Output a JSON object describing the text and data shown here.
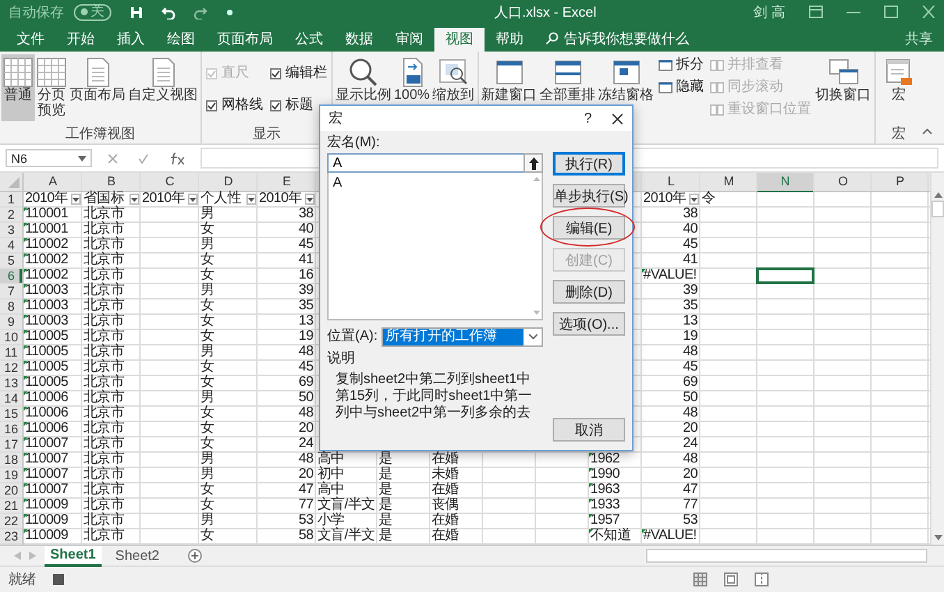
{
  "title_bar": {
    "autosave": {
      "label": "自动保存",
      "on": false,
      "state": "关"
    },
    "document_title": "人口.xlsx - Excel",
    "user": "剑 高"
  },
  "menu_tabs": [
    {
      "label": "文件",
      "selected": false
    },
    {
      "label": "开始",
      "selected": false
    },
    {
      "label": "插入",
      "selected": false
    },
    {
      "label": "绘图",
      "selected": false
    },
    {
      "label": "页面布局",
      "selected": false
    },
    {
      "label": "公式",
      "selected": false
    },
    {
      "label": "数据",
      "selected": false
    },
    {
      "label": "审阅",
      "selected": false
    },
    {
      "label": "视图",
      "selected": true
    },
    {
      "label": "帮助",
      "selected": false
    }
  ],
  "tell_me": "告诉我你想要做什么",
  "share": "共享",
  "ribbon": {
    "workbook_views": {
      "label": "工作簿视图",
      "items": [
        {
          "label": "普通",
          "selected": true
        },
        {
          "label": "分页预览",
          "selected": false
        },
        {
          "label": "页面布局",
          "selected": false
        },
        {
          "label": "自定义视图",
          "selected": false
        }
      ]
    },
    "show": {
      "label": "显示",
      "checkboxes": [
        {
          "label": "直尺",
          "checked": true,
          "disabled": true
        },
        {
          "label": "编辑栏",
          "checked": true,
          "disabled": false
        },
        {
          "label": "网格线",
          "checked": true,
          "disabled": false
        },
        {
          "label": "标题",
          "checked": true,
          "disabled": false
        }
      ]
    },
    "zoom": {
      "items": [
        {
          "label": "显示比例"
        },
        {
          "label": "100%"
        },
        {
          "label": "缩放到"
        }
      ]
    },
    "window": {
      "large": [
        {
          "label": "新建窗口"
        },
        {
          "label": "全部重排"
        },
        {
          "label": "冻结窗格"
        }
      ],
      "small": [
        {
          "label": "拆分",
          "disabled": false
        },
        {
          "label": "隐藏",
          "disabled": false
        }
      ],
      "small2": [
        {
          "label": "并排查看",
          "disabled": true
        },
        {
          "label": "同步滚动",
          "disabled": true
        },
        {
          "label": "重设窗口位置",
          "disabled": true
        }
      ],
      "switch": "切换窗口"
    },
    "macros": {
      "label": "宏",
      "button": "宏"
    }
  },
  "formula_bar": {
    "name_box": "N6"
  },
  "columns": [
    {
      "label": "A",
      "selected": false
    },
    {
      "label": "B",
      "selected": false
    },
    {
      "label": "C",
      "selected": false
    },
    {
      "label": "D",
      "selected": false
    },
    {
      "label": "E",
      "selected": false
    },
    null,
    null,
    null,
    null,
    null,
    null,
    {
      "label": "L",
      "selected": false
    },
    {
      "label": "M",
      "selected": false
    },
    {
      "label": "N",
      "selected": true
    },
    {
      "label": "O",
      "selected": false
    },
    {
      "label": "P",
      "selected": false
    }
  ],
  "rows": [
    {
      "number": "1",
      "selected": false,
      "cells": [
        {
          "kind": "header",
          "text": "2010年"
        },
        {
          "kind": "header",
          "text": "省国标"
        },
        {
          "kind": "header",
          "text": "2010年"
        },
        {
          "kind": "header",
          "text": "个人性"
        },
        {
          "kind": "header",
          "text": "2010年"
        },
        null,
        null,
        null,
        null,
        null,
        null,
        {
          "kind": "header",
          "text": "2010年"
        },
        {
          "kind": "text",
          "text": "令"
        },
        null,
        null,
        null
      ]
    },
    {
      "number": "2",
      "selected": false,
      "cells": [
        {
          "kind": "flagged",
          "text": "110001"
        },
        {
          "kind": "text",
          "text": "北京市"
        },
        null,
        {
          "kind": "text",
          "text": "男"
        },
        {
          "kind": "number",
          "text": "38"
        },
        null,
        null,
        null,
        null,
        null,
        null,
        {
          "kind": "number",
          "text": "38"
        },
        null,
        null,
        null,
        null
      ]
    },
    {
      "number": "3",
      "selected": false,
      "cells": [
        {
          "kind": "flagged",
          "text": "110001"
        },
        {
          "kind": "text",
          "text": "北京市"
        },
        null,
        {
          "kind": "text",
          "text": "女"
        },
        {
          "kind": "number",
          "text": "40"
        },
        null,
        null,
        null,
        null,
        null,
        null,
        {
          "kind": "number",
          "text": "40"
        },
        null,
        null,
        null,
        null
      ]
    },
    {
      "number": "4",
      "selected": false,
      "cells": [
        {
          "kind": "flagged",
          "text": "110002"
        },
        {
          "kind": "text",
          "text": "北京市"
        },
        null,
        {
          "kind": "text",
          "text": "男"
        },
        {
          "kind": "number",
          "text": "45"
        },
        null,
        null,
        null,
        null,
        null,
        null,
        {
          "kind": "number",
          "text": "45"
        },
        null,
        null,
        null,
        null
      ]
    },
    {
      "number": "5",
      "selected": false,
      "cells": [
        {
          "kind": "flagged",
          "text": "110002"
        },
        {
          "kind": "text",
          "text": "北京市"
        },
        null,
        {
          "kind": "text",
          "text": "女"
        },
        {
          "kind": "number",
          "text": "41"
        },
        null,
        null,
        null,
        null,
        null,
        null,
        {
          "kind": "number",
          "text": "41"
        },
        null,
        null,
        null,
        null
      ]
    },
    {
      "number": "6",
      "selected": true,
      "cells": [
        {
          "kind": "flagged",
          "text": "110002"
        },
        {
          "kind": "text",
          "text": "北京市"
        },
        null,
        {
          "kind": "text",
          "text": "女"
        },
        {
          "kind": "number",
          "text": "16"
        },
        null,
        null,
        null,
        null,
        null,
        null,
        {
          "kind": "flagged",
          "text": "#VALUE!"
        },
        null,
        {
          "kind": "cursor"
        },
        null,
        null
      ]
    },
    {
      "number": "7",
      "selected": false,
      "cells": [
        {
          "kind": "flagged",
          "text": "110003"
        },
        {
          "kind": "text",
          "text": "北京市"
        },
        null,
        {
          "kind": "text",
          "text": "男"
        },
        {
          "kind": "number",
          "text": "39"
        },
        null,
        null,
        null,
        null,
        null,
        null,
        {
          "kind": "number",
          "text": "39"
        },
        null,
        null,
        null,
        null
      ]
    },
    {
      "number": "8",
      "selected": false,
      "cells": [
        {
          "kind": "flagged",
          "text": "110003"
        },
        {
          "kind": "text",
          "text": "北京市"
        },
        null,
        {
          "kind": "text",
          "text": "女"
        },
        {
          "kind": "number",
          "text": "35"
        },
        null,
        null,
        null,
        null,
        null,
        null,
        {
          "kind": "number",
          "text": "35"
        },
        null,
        null,
        null,
        null
      ]
    },
    {
      "number": "9",
      "selected": false,
      "cells": [
        {
          "kind": "flagged",
          "text": "110003"
        },
        {
          "kind": "text",
          "text": "北京市"
        },
        null,
        {
          "kind": "text",
          "text": "女"
        },
        {
          "kind": "number",
          "text": "13"
        },
        null,
        null,
        null,
        null,
        null,
        null,
        {
          "kind": "number",
          "text": "13"
        },
        null,
        null,
        null,
        null
      ]
    },
    {
      "number": "10",
      "selected": false,
      "cells": [
        {
          "kind": "flagged",
          "text": "110005"
        },
        {
          "kind": "text",
          "text": "北京市"
        },
        null,
        {
          "kind": "text",
          "text": "女"
        },
        {
          "kind": "number",
          "text": "19"
        },
        null,
        null,
        null,
        null,
        null,
        null,
        {
          "kind": "number",
          "text": "19"
        },
        null,
        null,
        null,
        null
      ]
    },
    {
      "number": "11",
      "selected": false,
      "cells": [
        {
          "kind": "flagged",
          "text": "110005"
        },
        {
          "kind": "text",
          "text": "北京市"
        },
        null,
        {
          "kind": "text",
          "text": "男"
        },
        {
          "kind": "number",
          "text": "48"
        },
        null,
        null,
        null,
        null,
        null,
        null,
        {
          "kind": "number",
          "text": "48"
        },
        null,
        null,
        null,
        null
      ]
    },
    {
      "number": "12",
      "selected": false,
      "cells": [
        {
          "kind": "flagged",
          "text": "110005"
        },
        {
          "kind": "text",
          "text": "北京市"
        },
        null,
        {
          "kind": "text",
          "text": "女"
        },
        {
          "kind": "number",
          "text": "45"
        },
        null,
        null,
        null,
        null,
        null,
        null,
        {
          "kind": "number",
          "text": "45"
        },
        null,
        null,
        null,
        null
      ]
    },
    {
      "number": "13",
      "selected": false,
      "cells": [
        {
          "kind": "flagged",
          "text": "110005"
        },
        {
          "kind": "text",
          "text": "北京市"
        },
        null,
        {
          "kind": "text",
          "text": "女"
        },
        {
          "kind": "number",
          "text": "69"
        },
        null,
        null,
        null,
        null,
        null,
        null,
        {
          "kind": "number",
          "text": "69"
        },
        null,
        null,
        null,
        null
      ]
    },
    {
      "number": "14",
      "selected": false,
      "cells": [
        {
          "kind": "flagged",
          "text": "110006"
        },
        {
          "kind": "text",
          "text": "北京市"
        },
        null,
        {
          "kind": "text",
          "text": "男"
        },
        {
          "kind": "number",
          "text": "50"
        },
        null,
        null,
        null,
        null,
        null,
        null,
        {
          "kind": "number",
          "text": "50"
        },
        null,
        null,
        null,
        null
      ]
    },
    {
      "number": "15",
      "selected": false,
      "cells": [
        {
          "kind": "flagged",
          "text": "110006"
        },
        {
          "kind": "text",
          "text": "北京市"
        },
        null,
        {
          "kind": "text",
          "text": "女"
        },
        {
          "kind": "number",
          "text": "48"
        },
        null,
        null,
        null,
        null,
        null,
        null,
        {
          "kind": "number",
          "text": "48"
        },
        null,
        null,
        null,
        null
      ]
    },
    {
      "number": "16",
      "selected": false,
      "cells": [
        {
          "kind": "flagged",
          "text": "110006"
        },
        {
          "kind": "text",
          "text": "北京市"
        },
        null,
        {
          "kind": "text",
          "text": "女"
        },
        {
          "kind": "number",
          "text": "20"
        },
        null,
        null,
        null,
        null,
        null,
        null,
        {
          "kind": "number",
          "text": "20"
        },
        null,
        null,
        null,
        null
      ]
    },
    {
      "number": "17",
      "selected": false,
      "cells": [
        {
          "kind": "flagged",
          "text": "110007"
        },
        {
          "kind": "text",
          "text": "北京市"
        },
        null,
        {
          "kind": "text",
          "text": "女"
        },
        {
          "kind": "number",
          "text": "24"
        },
        null,
        null,
        null,
        null,
        null,
        null,
        {
          "kind": "number",
          "text": "24"
        },
        null,
        null,
        null,
        null
      ]
    },
    {
      "number": "18",
      "selected": false,
      "cells": [
        {
          "kind": "flagged",
          "text": "110007"
        },
        {
          "kind": "text",
          "text": "北京市"
        },
        null,
        {
          "kind": "text",
          "text": "男"
        },
        {
          "kind": "number",
          "text": "48"
        },
        {
          "kind": "text",
          "text": "高中"
        },
        {
          "kind": "text",
          "text": "是"
        },
        {
          "kind": "text",
          "text": "在婚"
        },
        null,
        null,
        {
          "kind": "flagged",
          "text": "1962"
        },
        {
          "kind": "number",
          "text": "48"
        },
        null,
        null,
        null,
        null
      ]
    },
    {
      "number": "19",
      "selected": false,
      "cells": [
        {
          "kind": "flagged",
          "text": "110007"
        },
        {
          "kind": "text",
          "text": "北京市"
        },
        null,
        {
          "kind": "text",
          "text": "男"
        },
        {
          "kind": "number",
          "text": "20"
        },
        {
          "kind": "text",
          "text": "初中"
        },
        {
          "kind": "text",
          "text": "是"
        },
        {
          "kind": "text",
          "text": "未婚"
        },
        null,
        null,
        {
          "kind": "flagged",
          "text": "1990"
        },
        {
          "kind": "number",
          "text": "20"
        },
        null,
        null,
        null,
        null
      ]
    },
    {
      "number": "20",
      "selected": false,
      "cells": [
        {
          "kind": "flagged",
          "text": "110007"
        },
        {
          "kind": "text",
          "text": "北京市"
        },
        null,
        {
          "kind": "text",
          "text": "女"
        },
        {
          "kind": "number",
          "text": "47"
        },
        {
          "kind": "text",
          "text": "高中"
        },
        {
          "kind": "text",
          "text": "是"
        },
        {
          "kind": "text",
          "text": "在婚"
        },
        null,
        null,
        {
          "kind": "flagged",
          "text": "1963"
        },
        {
          "kind": "number",
          "text": "47"
        },
        null,
        null,
        null,
        null
      ]
    },
    {
      "number": "21",
      "selected": false,
      "cells": [
        {
          "kind": "flagged",
          "text": "110009"
        },
        {
          "kind": "text",
          "text": "北京市"
        },
        null,
        {
          "kind": "text",
          "text": "女"
        },
        {
          "kind": "number",
          "text": "77"
        },
        {
          "kind": "text",
          "text": "文盲/半文"
        },
        {
          "kind": "text",
          "text": "是"
        },
        {
          "kind": "text",
          "text": "丧偶"
        },
        null,
        null,
        {
          "kind": "flagged",
          "text": "1933"
        },
        {
          "kind": "number",
          "text": "77"
        },
        null,
        null,
        null,
        null
      ]
    },
    {
      "number": "22",
      "selected": false,
      "cells": [
        {
          "kind": "flagged",
          "text": "110009"
        },
        {
          "kind": "text",
          "text": "北京市"
        },
        null,
        {
          "kind": "text",
          "text": "男"
        },
        {
          "kind": "number",
          "text": "53"
        },
        {
          "kind": "text",
          "text": "小学"
        },
        {
          "kind": "text",
          "text": "是"
        },
        {
          "kind": "text",
          "text": "在婚"
        },
        null,
        null,
        {
          "kind": "flagged",
          "text": "1957"
        },
        {
          "kind": "number",
          "text": "53"
        },
        null,
        null,
        null,
        null
      ]
    },
    {
      "number": "23",
      "selected": false,
      "cells": [
        {
          "kind": "flagged",
          "text": "110009"
        },
        {
          "kind": "text",
          "text": "北京市"
        },
        null,
        {
          "kind": "text",
          "text": "女"
        },
        {
          "kind": "number",
          "text": "58"
        },
        {
          "kind": "text",
          "text": "文盲/半文"
        },
        {
          "kind": "text",
          "text": "是"
        },
        {
          "kind": "text",
          "text": "在婚"
        },
        null,
        null,
        {
          "kind": "flagged",
          "text": "不知道"
        },
        {
          "kind": "flagged",
          "text": "#VALUE!"
        },
        null,
        null,
        null,
        null
      ]
    }
  ],
  "sheets": [
    {
      "name": "Sheet1",
      "selected": true
    },
    {
      "name": "Sheet2",
      "selected": false
    }
  ],
  "status": "就绪",
  "macro_dialog": {
    "title": "宏",
    "help": "?",
    "name_label": "宏名(M):",
    "name_value": "A",
    "macros": [
      {
        "name": "A"
      }
    ],
    "location_label": "位置(A):",
    "location_value": "所有打开的工作簿",
    "description_label": "说明",
    "description": "复制sheet2中第二列到sheet1中第15列，于此同时sheet1中第一列中与sheet2中第一列多余的去",
    "buttons": [
      {
        "label": "执行(R)",
        "default": true,
        "disabled": false,
        "circled": false
      },
      {
        "label": "单步执行(S)",
        "default": false,
        "disabled": false,
        "circled": false
      },
      {
        "label": "编辑(E)",
        "default": false,
        "disabled": false,
        "circled": true
      },
      {
        "label": "创建(C)",
        "default": false,
        "disabled": true,
        "circled": false
      },
      {
        "label": "删除(D)",
        "default": false,
        "disabled": false,
        "circled": false
      },
      {
        "label": "选项(O)...",
        "default": false,
        "disabled": false,
        "circled": false
      }
    ],
    "cancel": "取消"
  }
}
